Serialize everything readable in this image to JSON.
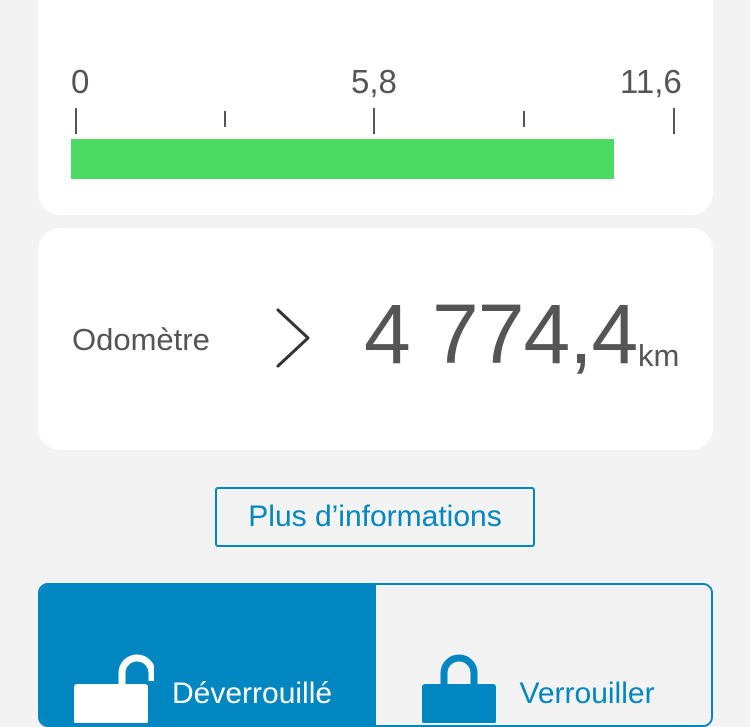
{
  "gauge": {
    "min_label": "0",
    "mid_label": "5,8",
    "max_label": "11,6",
    "min": 0,
    "max": 11.6,
    "fill_value": 10.5,
    "fill_color": "#4cd964"
  },
  "odometer": {
    "label": "Odomètre",
    "value": "4 774,4",
    "unit": "km",
    "chevron_icon": "chevron-right-icon"
  },
  "more_info": {
    "label": "Plus d’informations"
  },
  "lock_control": {
    "accent_color": "#0086c0",
    "unlocked": {
      "label": "Déverrouillé",
      "icon": "unlocked-padlock-icon",
      "selected": true
    },
    "lock": {
      "label": "Verrouiller",
      "icon": "padlock-icon",
      "selected": false
    }
  }
}
